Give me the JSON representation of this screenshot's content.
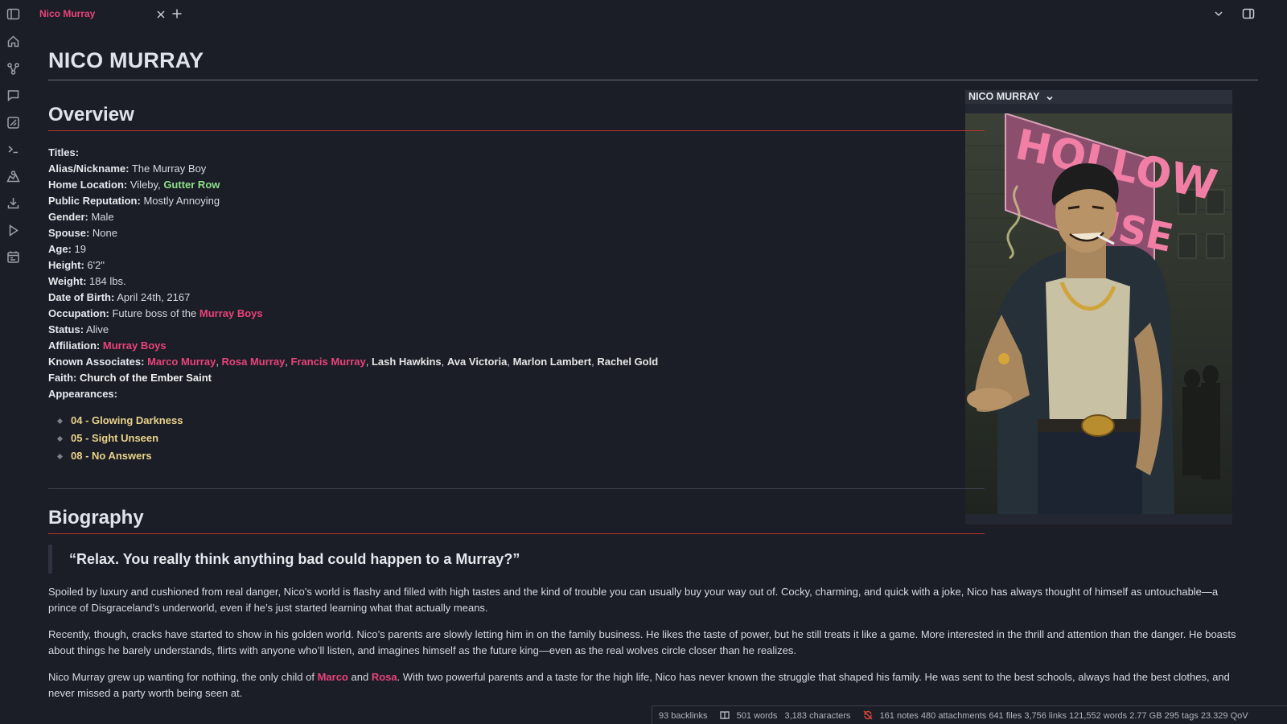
{
  "tab": {
    "title": "Nico Murray"
  },
  "page": {
    "title": "NICO MURRAY"
  },
  "infobox": {
    "header": "NICO MURRAY",
    "portrait_sign": "HOLLOW HOUSE"
  },
  "overview": {
    "heading": "Overview",
    "fields": {
      "titles_label": "Titles:",
      "alias_label": "Alias/Nickname:",
      "alias_value": "The Murray Boy",
      "home_label": "Home Location:",
      "home_value": "Vileby,",
      "home_link": "Gutter Row",
      "reputation_label": "Public Reputation:",
      "reputation_value": "Mostly Annoying",
      "gender_label": "Gender:",
      "gender_value": "Male",
      "spouse_label": "Spouse:",
      "spouse_value": "None",
      "age_label": "Age:",
      "age_value": "19",
      "height_label": "Height:",
      "height_value": "6'2\"",
      "weight_label": "Weight:",
      "weight_value": "184 lbs.",
      "dob_label": "Date of Birth:",
      "dob_value": "April 24th, 2167",
      "occupation_label": "Occupation:",
      "occupation_value": "Future boss of the",
      "occupation_link": "Murray Boys",
      "status_label": "Status:",
      "status_value": "Alive",
      "affiliation_label": "Affiliation:",
      "affiliation_link": "Murray Boys",
      "associates_label": "Known Associates:",
      "associates": [
        "Marco Murray",
        "Rosa Murray",
        "Francis Murray",
        "Lash Hawkins",
        "Ava Victoria",
        "Marlon Lambert",
        "Rachel Gold"
      ],
      "faith_label": "Faith:",
      "faith_link": "Church of the Ember Saint",
      "appearances_label": "Appearances:"
    },
    "appearances": [
      "04 - Glowing Darkness",
      "05 - Sight Unseen",
      "08 - No Answers"
    ]
  },
  "biography": {
    "heading": "Biography",
    "quote": "“Relax. You really think anything bad could happen to a Murray?”",
    "p1": "Spoiled by luxury and cushioned from real danger, Nico’s world is flashy and filled with high tastes and the kind of trouble you can usually buy your way out of. Cocky, charming, and quick with a joke, Nico has always thought of himself as untouchable—a prince of Disgraceland’s underworld, even if he’s just started learning what that actually means.",
    "p2": "Recently, though, cracks have started to show in his golden world. Nico’s parents are slowly letting him in on the family business. He likes the taste of power, but he still treats it like a game. More interested in the thrill and attention than the danger. He boasts about things he barely understands, flirts with anyone who’ll listen, and imagines himself as the future king—even as the real wolves circle closer than he realizes.",
    "p3_a": "Nico Murray grew up wanting for nothing, the only child of",
    "p3_link1": "Marco",
    "p3_b": "and",
    "p3_link2": "Rosa",
    "p3_c": ". With two powerful parents and a taste for the high life, Nico has never known the struggle that shaped his family. He was sent to the best schools, always had the best clothes, and never missed a party worth being seen at."
  },
  "statusbar": {
    "backlinks": "93 backlinks",
    "words": "501 words",
    "characters": "3,183 characters",
    "vault": "161 notes 480 attachments 641 files 3,756 links 121,552 words 2.77 GB 295 tags 23.329 QoV"
  },
  "colors": {
    "accent": "#e8437b",
    "link_green": "#8fe08a",
    "appearance_link": "#e8d38a",
    "heading_rule": "#b8352f"
  }
}
